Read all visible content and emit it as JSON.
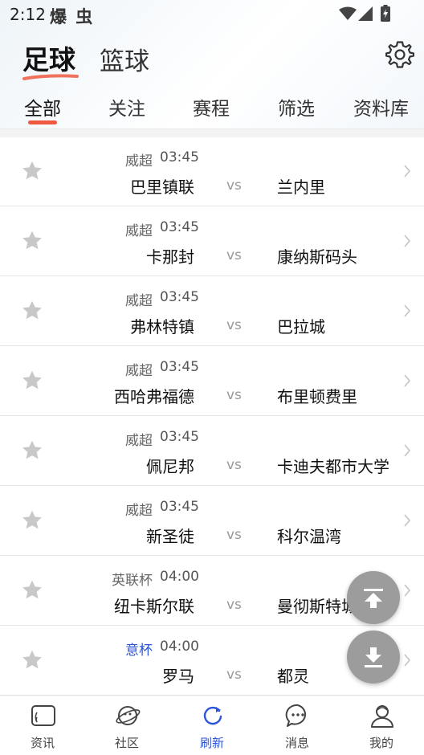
{
  "status_bar": {
    "time": "2:12",
    "app_name": "爆 虫"
  },
  "sport_tabs": [
    {
      "label": "足球",
      "active": true
    },
    {
      "label": "篮球",
      "active": false
    }
  ],
  "sub_tabs": [
    {
      "label": "全部"
    },
    {
      "label": "关注"
    },
    {
      "label": "赛程"
    },
    {
      "label": "筛选"
    },
    {
      "label": "资料库"
    }
  ],
  "matches": [
    {
      "league": "威超",
      "time": "03:45",
      "home": "巴里镇联",
      "vs": "vs",
      "away": "兰内里"
    },
    {
      "league": "威超",
      "time": "03:45",
      "home": "卡那封",
      "vs": "vs",
      "away": "康纳斯码头"
    },
    {
      "league": "威超",
      "time": "03:45",
      "home": "弗林特镇",
      "vs": "vs",
      "away": "巴拉城"
    },
    {
      "league": "威超",
      "time": "03:45",
      "home": "西哈弗福德",
      "vs": "vs",
      "away": "布里顿费里"
    },
    {
      "league": "威超",
      "time": "03:45",
      "home": "佩尼邦",
      "vs": "vs",
      "away": "卡迪夫都市大学"
    },
    {
      "league": "威超",
      "time": "03:45",
      "home": "新圣徒",
      "vs": "vs",
      "away": "科尔温湾"
    },
    {
      "league": "英联杯",
      "time": "04:00",
      "home": "纽卡斯尔联",
      "vs": "vs",
      "away": "曼彻斯特城"
    },
    {
      "league": "意杯",
      "time": "04:00",
      "home": "罗马",
      "vs": "vs",
      "away": "都灵",
      "league_color": "#2c55d9"
    }
  ],
  "bottom_nav": [
    {
      "label": "资讯",
      "icon": "news-icon"
    },
    {
      "label": "社区",
      "icon": "community-planet-icon"
    },
    {
      "label": "刷新",
      "icon": "refresh-icon",
      "active": true
    },
    {
      "label": "消息",
      "icon": "message-icon"
    },
    {
      "label": "我的",
      "icon": "profile-icon"
    }
  ],
  "colors": {
    "accent": "#ef5a3e",
    "active_nav": "#2c55d9",
    "fab": "#9c9c9c"
  }
}
